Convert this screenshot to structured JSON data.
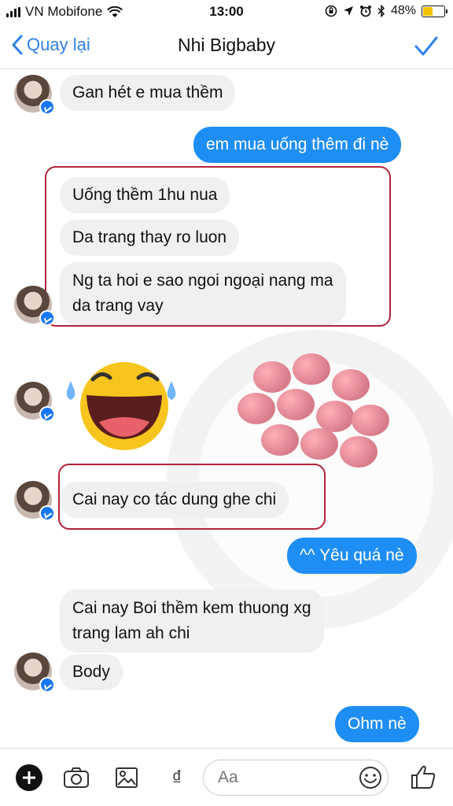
{
  "status_bar": {
    "carrier": "VN Mobifone",
    "time": "13:00",
    "battery": "48%",
    "battery_level": 0.48
  },
  "header": {
    "back_label": "Quay lại",
    "title": "Nhi Bigbaby"
  },
  "messages": [
    {
      "side": "in",
      "text": "Gan hét e mua thềm"
    },
    {
      "side": "out",
      "text": "em mua uống thêm đi nè"
    },
    {
      "side": "in",
      "text": "Uống thềm 1hu nua"
    },
    {
      "side": "in",
      "text": "Da trang thay ro luon"
    },
    {
      "side": "in",
      "lines": [
        "Ng ta hoi e sao ngoi ngoại nang ma",
        "da trang vay"
      ]
    },
    {
      "side": "in",
      "text": "Cai nay co tác dung ghe chi"
    },
    {
      "side": "out",
      "text": "^^ Yêu quá nè"
    },
    {
      "side": "in",
      "lines": [
        "Cai nay Boi thềm kem thuong xg",
        "trang lam ah chi"
      ]
    },
    {
      "side": "in",
      "text": "Body"
    },
    {
      "side": "out",
      "text": "Ohm nè"
    }
  ],
  "composer": {
    "placeholder": "Aa",
    "currency_symbol": "₫"
  },
  "icons": {
    "add": "plus-circle-icon",
    "camera": "camera-icon",
    "gallery": "image-icon",
    "emoji": "smile-icon",
    "like": "thumbs-up-icon",
    "done": "checkmark-icon",
    "back": "chevron-left-icon"
  },
  "colors": {
    "accent": "#1e8ef5",
    "incoming_bubble": "#f0f0f0",
    "highlight_box": "#b3223a"
  }
}
